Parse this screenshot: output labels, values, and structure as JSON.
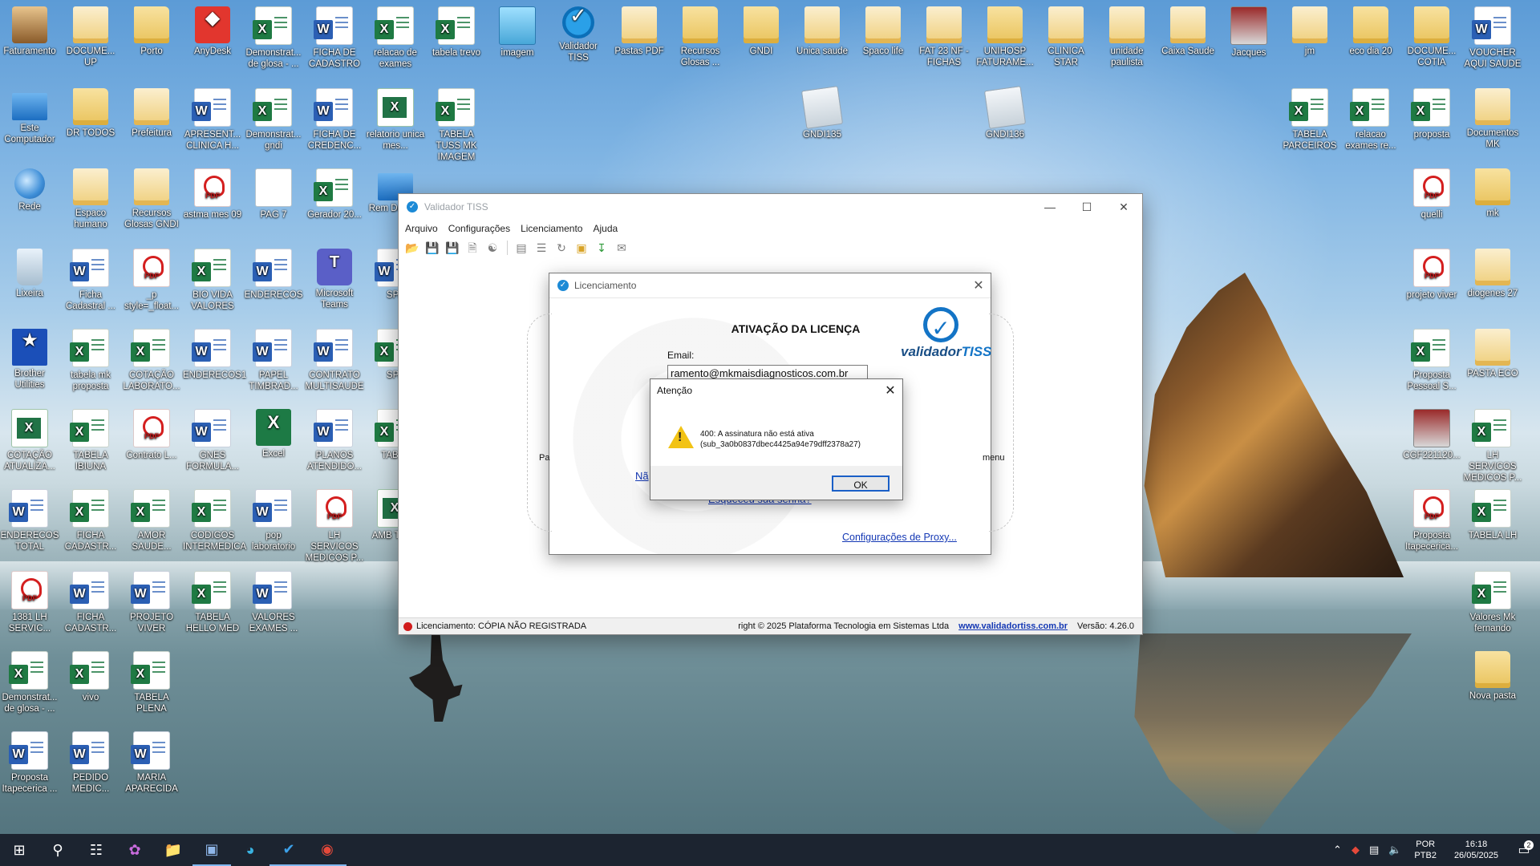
{
  "desktop": {
    "icons": [
      {
        "label": "Faturamento",
        "kind": "contact"
      },
      {
        "label": "DOCUME... UP",
        "kind": "folder-doc"
      },
      {
        "label": "Porto",
        "kind": "folder"
      },
      {
        "label": "AnyDesk",
        "kind": "red"
      },
      {
        "label": "Demonstrat... de glosa - ...",
        "kind": "xls"
      },
      {
        "label": "FICHA DE CADASTRO",
        "kind": "doc"
      },
      {
        "label": "relacao de exames",
        "kind": "xls"
      },
      {
        "label": "tabela trevo",
        "kind": "xls"
      },
      {
        "label": "imagem",
        "kind": "img"
      },
      {
        "label": "Validador TISS",
        "kind": "vtiss"
      },
      {
        "label": "Pastas PDF",
        "kind": "folder-doc"
      },
      {
        "label": "Recursos Glosas ...",
        "kind": "folder"
      },
      {
        "label": "GNDI",
        "kind": "folder"
      },
      {
        "label": "Unica saude",
        "kind": "folder-doc"
      },
      {
        "label": "Spaco life",
        "kind": "folder-doc"
      },
      {
        "label": "FAT 23 NF - FICHAS",
        "kind": "folder-doc"
      },
      {
        "label": "UNIHOSP FATURAME...",
        "kind": "folder"
      },
      {
        "label": "CLINICA STAR",
        "kind": "folder-doc"
      },
      {
        "label": "unidade paulista",
        "kind": "folder-doc"
      },
      {
        "label": "Caixa Saude",
        "kind": "folder-doc"
      },
      {
        "label": "Jacques",
        "kind": "photo"
      },
      {
        "label": "jm",
        "kind": "folder-doc"
      },
      {
        "label": "eco dia 20",
        "kind": "folder"
      },
      {
        "label": "DOCUME... COTIA",
        "kind": "folder"
      },
      {
        "label": "VOUCHER AQUI SAUDE",
        "kind": "doc"
      },
      {
        "label": "Este Computador",
        "kind": "pc"
      },
      {
        "label": "DR TODOS",
        "kind": "folder"
      },
      {
        "label": "Prefeitura",
        "kind": "folder-doc"
      },
      {
        "label": "APRESENT... CLINICA H...",
        "kind": "doc"
      },
      {
        "label": "Demonstrat... gndi",
        "kind": "xls"
      },
      {
        "label": "FICHA DE CREDENC...",
        "kind": "doc"
      },
      {
        "label": "relatorio unica mes...",
        "kind": "xls-green"
      },
      {
        "label": "TABELA TUSS MK IMAGEM",
        "kind": "xls"
      },
      {
        "label": "GNDI135",
        "kind": "zip"
      },
      {
        "label": "GNDI136",
        "kind": "zip"
      },
      {
        "label": "TABELA PARCEIROS",
        "kind": "xls"
      },
      {
        "label": "relacao exames re...",
        "kind": "xls"
      },
      {
        "label": "proposta",
        "kind": "xls"
      },
      {
        "label": "Documentos MK",
        "kind": "folder-doc"
      },
      {
        "label": "Rede",
        "kind": "globe"
      },
      {
        "label": "Espaco humano",
        "kind": "folder-doc"
      },
      {
        "label": "Recursos Glosas GNDI",
        "kind": "folder-doc"
      },
      {
        "label": "astma mes 09",
        "kind": "pdf"
      },
      {
        "label": "PAG 7",
        "kind": "notepad"
      },
      {
        "label": "Gerador 20...",
        "kind": "xls"
      },
      {
        "label": "Rem Deskt...",
        "kind": "pc"
      },
      {
        "label": "quelli",
        "kind": "pdf"
      },
      {
        "label": "mk",
        "kind": "folder"
      },
      {
        "label": "Lixeira",
        "kind": "bin"
      },
      {
        "label": "Ficha Cadastral ...",
        "kind": "doc"
      },
      {
        "label": "_p style=_float...",
        "kind": "pdf"
      },
      {
        "label": "BIO VIDA VALORES",
        "kind": "xls"
      },
      {
        "label": "ENDERECOS",
        "kind": "doc"
      },
      {
        "label": "Microsoft Teams",
        "kind": "teams"
      },
      {
        "label": "SPA",
        "kind": "doc"
      },
      {
        "label": "projeto viver",
        "kind": "pdf"
      },
      {
        "label": "diogenes 27",
        "kind": "folder-doc"
      },
      {
        "label": "Brother Utilities",
        "kind": "brother"
      },
      {
        "label": "tabela mk proposta",
        "kind": "xls"
      },
      {
        "label": "COTAÇÃO LABORATO...",
        "kind": "xls"
      },
      {
        "label": "ENDERECOS1",
        "kind": "doc"
      },
      {
        "label": "PAPEL TIMBRAD...",
        "kind": "doc"
      },
      {
        "label": "CONTRATO MULTISAUDE",
        "kind": "doc"
      },
      {
        "label": "SPA",
        "kind": "xls"
      },
      {
        "label": "Proposta Pessoal S...",
        "kind": "xls"
      },
      {
        "label": "PASTA ECO",
        "kind": "folder-doc"
      },
      {
        "label": "COTAÇÃO ATUALIZA...",
        "kind": "xls-green"
      },
      {
        "label": "TABELA IBIUNA",
        "kind": "xls"
      },
      {
        "label": "Contrato L...",
        "kind": "pdf"
      },
      {
        "label": "GNES FORMULA...",
        "kind": "doc"
      },
      {
        "label": "Excel",
        "kind": "excel-app"
      },
      {
        "label": "PLANOS ATENDIDO...",
        "kind": "doc"
      },
      {
        "label": "TABEL",
        "kind": "xls"
      },
      {
        "label": "CGF221120...",
        "kind": "photo"
      },
      {
        "label": "LH SERVICOS MEDICOS P...",
        "kind": "xls"
      },
      {
        "label": "ENDERECOS TOTAL",
        "kind": "doc"
      },
      {
        "label": "FICHA CADASTR...",
        "kind": "xls"
      },
      {
        "label": "AMOR SAUDE...",
        "kind": "xls"
      },
      {
        "label": "CODIGOS INTERMEDICA",
        "kind": "xls"
      },
      {
        "label": "pop laboratorio",
        "kind": "doc"
      },
      {
        "label": "LH SERVICOS MEDICOS P...",
        "kind": "pdf"
      },
      {
        "label": "AMB TUSS",
        "kind": "xls-green"
      },
      {
        "label": "Proposta Itapecerica...",
        "kind": "pdf"
      },
      {
        "label": "TABELA LH",
        "kind": "xls"
      },
      {
        "label": "1381 LH SERVIC...",
        "kind": "pdf"
      },
      {
        "label": "FICHA CADASTR...",
        "kind": "doc"
      },
      {
        "label": "PROJETO VIVER",
        "kind": "doc"
      },
      {
        "label": "TABELA HELLO MED",
        "kind": "xls"
      },
      {
        "label": "VALORES EXAMES ...",
        "kind": "doc"
      },
      {
        "label": "Valores Mk fernando",
        "kind": "xls"
      },
      {
        "label": "Demonstrat... de glosa - ...",
        "kind": "xls"
      },
      {
        "label": "vivo",
        "kind": "xls"
      },
      {
        "label": "TABELA PLENA",
        "kind": "xls"
      },
      {
        "label": "Nova pasta",
        "kind": "folder"
      },
      {
        "label": "Proposta Itapecerica ...",
        "kind": "doc"
      },
      {
        "label": "PEDIDO MEDIC...",
        "kind": "doc"
      },
      {
        "label": "MARIA APARECIDA",
        "kind": "doc"
      }
    ]
  },
  "main_window": {
    "title": "Validador TISS",
    "menu": [
      "Arquivo",
      "Configurações",
      "Licenciamento",
      "Ajuda"
    ],
    "toolbar_icons": [
      "open-icon",
      "save-icon",
      "save-all-icon",
      "print-preview-icon",
      "binoculars-icon",
      "report-icon",
      "list-icon",
      "sync-icon",
      "package-icon",
      "download-icon",
      "mail-icon"
    ],
    "status": {
      "license": "Licenciamento: CÓPIA NÃO REGISTRADA",
      "copyright": "right © 2025 Plataforma Tecnologia em Sistemas Ltda",
      "site": "www.validadortiss.com.br",
      "version": "Versão: 4.26.0"
    }
  },
  "license_dialog": {
    "title": "Licenciamento",
    "heading": "ATIVAÇÃO DA LICENÇA",
    "logo_prefix": "validador",
    "logo_suffix": "TISS",
    "email_label": "Email:",
    "email_value": "ramento@mkmaisdiagnosticos.com.br",
    "forgot_link": "Esqueceu sua senha?",
    "proxy_link": "Configurações de Proxy...",
    "left_fragment": "Pa",
    "left_link_fragment": "Nã",
    "right_fragment": "menu"
  },
  "alert_dialog": {
    "title": "Atenção",
    "message_line1": "400: A assinatura não está ativa",
    "message_line2": "(sub_3a0b0837dbec4425a94e79dff2378a27)",
    "ok_label": "OK"
  },
  "taskbar": {
    "apps": [
      "windows-start-icon",
      "search-icon",
      "task-view-icon",
      "copilot-icon",
      "file-explorer-icon",
      "desktop-app-icon",
      "edge-icon",
      "validador-tiss-icon",
      "chrome-icon"
    ],
    "lang_line1": "POR",
    "lang_line2": "PTB2",
    "time": "16:18",
    "date": "26/05/2025",
    "notifications": "2"
  },
  "colors": {
    "link": "#1438b4",
    "status_error": "#d11c1c",
    "brand": "#1374c6",
    "taskbar": "#1c2430"
  }
}
